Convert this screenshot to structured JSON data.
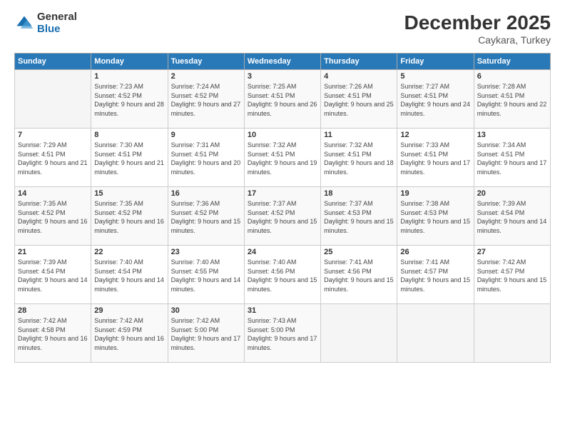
{
  "logo": {
    "general": "General",
    "blue": "Blue"
  },
  "title": "December 2025",
  "location": "Caykara, Turkey",
  "days_header": [
    "Sunday",
    "Monday",
    "Tuesday",
    "Wednesday",
    "Thursday",
    "Friday",
    "Saturday"
  ],
  "weeks": [
    [
      {
        "day": "",
        "sunrise": "",
        "sunset": "",
        "daylight": ""
      },
      {
        "day": "1",
        "sunrise": "Sunrise: 7:23 AM",
        "sunset": "Sunset: 4:52 PM",
        "daylight": "Daylight: 9 hours and 28 minutes."
      },
      {
        "day": "2",
        "sunrise": "Sunrise: 7:24 AM",
        "sunset": "Sunset: 4:52 PM",
        "daylight": "Daylight: 9 hours and 27 minutes."
      },
      {
        "day": "3",
        "sunrise": "Sunrise: 7:25 AM",
        "sunset": "Sunset: 4:51 PM",
        "daylight": "Daylight: 9 hours and 26 minutes."
      },
      {
        "day": "4",
        "sunrise": "Sunrise: 7:26 AM",
        "sunset": "Sunset: 4:51 PM",
        "daylight": "Daylight: 9 hours and 25 minutes."
      },
      {
        "day": "5",
        "sunrise": "Sunrise: 7:27 AM",
        "sunset": "Sunset: 4:51 PM",
        "daylight": "Daylight: 9 hours and 24 minutes."
      },
      {
        "day": "6",
        "sunrise": "Sunrise: 7:28 AM",
        "sunset": "Sunset: 4:51 PM",
        "daylight": "Daylight: 9 hours and 22 minutes."
      }
    ],
    [
      {
        "day": "7",
        "sunrise": "Sunrise: 7:29 AM",
        "sunset": "Sunset: 4:51 PM",
        "daylight": "Daylight: 9 hours and 21 minutes."
      },
      {
        "day": "8",
        "sunrise": "Sunrise: 7:30 AM",
        "sunset": "Sunset: 4:51 PM",
        "daylight": "Daylight: 9 hours and 21 minutes."
      },
      {
        "day": "9",
        "sunrise": "Sunrise: 7:31 AM",
        "sunset": "Sunset: 4:51 PM",
        "daylight": "Daylight: 9 hours and 20 minutes."
      },
      {
        "day": "10",
        "sunrise": "Sunrise: 7:32 AM",
        "sunset": "Sunset: 4:51 PM",
        "daylight": "Daylight: 9 hours and 19 minutes."
      },
      {
        "day": "11",
        "sunrise": "Sunrise: 7:32 AM",
        "sunset": "Sunset: 4:51 PM",
        "daylight": "Daylight: 9 hours and 18 minutes."
      },
      {
        "day": "12",
        "sunrise": "Sunrise: 7:33 AM",
        "sunset": "Sunset: 4:51 PM",
        "daylight": "Daylight: 9 hours and 17 minutes."
      },
      {
        "day": "13",
        "sunrise": "Sunrise: 7:34 AM",
        "sunset": "Sunset: 4:51 PM",
        "daylight": "Daylight: 9 hours and 17 minutes."
      }
    ],
    [
      {
        "day": "14",
        "sunrise": "Sunrise: 7:35 AM",
        "sunset": "Sunset: 4:52 PM",
        "daylight": "Daylight: 9 hours and 16 minutes."
      },
      {
        "day": "15",
        "sunrise": "Sunrise: 7:35 AM",
        "sunset": "Sunset: 4:52 PM",
        "daylight": "Daylight: 9 hours and 16 minutes."
      },
      {
        "day": "16",
        "sunrise": "Sunrise: 7:36 AM",
        "sunset": "Sunset: 4:52 PM",
        "daylight": "Daylight: 9 hours and 15 minutes."
      },
      {
        "day": "17",
        "sunrise": "Sunrise: 7:37 AM",
        "sunset": "Sunset: 4:52 PM",
        "daylight": "Daylight: 9 hours and 15 minutes."
      },
      {
        "day": "18",
        "sunrise": "Sunrise: 7:37 AM",
        "sunset": "Sunset: 4:53 PM",
        "daylight": "Daylight: 9 hours and 15 minutes."
      },
      {
        "day": "19",
        "sunrise": "Sunrise: 7:38 AM",
        "sunset": "Sunset: 4:53 PM",
        "daylight": "Daylight: 9 hours and 15 minutes."
      },
      {
        "day": "20",
        "sunrise": "Sunrise: 7:39 AM",
        "sunset": "Sunset: 4:54 PM",
        "daylight": "Daylight: 9 hours and 14 minutes."
      }
    ],
    [
      {
        "day": "21",
        "sunrise": "Sunrise: 7:39 AM",
        "sunset": "Sunset: 4:54 PM",
        "daylight": "Daylight: 9 hours and 14 minutes."
      },
      {
        "day": "22",
        "sunrise": "Sunrise: 7:40 AM",
        "sunset": "Sunset: 4:54 PM",
        "daylight": "Daylight: 9 hours and 14 minutes."
      },
      {
        "day": "23",
        "sunrise": "Sunrise: 7:40 AM",
        "sunset": "Sunset: 4:55 PM",
        "daylight": "Daylight: 9 hours and 14 minutes."
      },
      {
        "day": "24",
        "sunrise": "Sunrise: 7:40 AM",
        "sunset": "Sunset: 4:56 PM",
        "daylight": "Daylight: 9 hours and 15 minutes."
      },
      {
        "day": "25",
        "sunrise": "Sunrise: 7:41 AM",
        "sunset": "Sunset: 4:56 PM",
        "daylight": "Daylight: 9 hours and 15 minutes."
      },
      {
        "day": "26",
        "sunrise": "Sunrise: 7:41 AM",
        "sunset": "Sunset: 4:57 PM",
        "daylight": "Daylight: 9 hours and 15 minutes."
      },
      {
        "day": "27",
        "sunrise": "Sunrise: 7:42 AM",
        "sunset": "Sunset: 4:57 PM",
        "daylight": "Daylight: 9 hours and 15 minutes."
      }
    ],
    [
      {
        "day": "28",
        "sunrise": "Sunrise: 7:42 AM",
        "sunset": "Sunset: 4:58 PM",
        "daylight": "Daylight: 9 hours and 16 minutes."
      },
      {
        "day": "29",
        "sunrise": "Sunrise: 7:42 AM",
        "sunset": "Sunset: 4:59 PM",
        "daylight": "Daylight: 9 hours and 16 minutes."
      },
      {
        "day": "30",
        "sunrise": "Sunrise: 7:42 AM",
        "sunset": "Sunset: 5:00 PM",
        "daylight": "Daylight: 9 hours and 17 minutes."
      },
      {
        "day": "31",
        "sunrise": "Sunrise: 7:43 AM",
        "sunset": "Sunset: 5:00 PM",
        "daylight": "Daylight: 9 hours and 17 minutes."
      },
      {
        "day": "",
        "sunrise": "",
        "sunset": "",
        "daylight": ""
      },
      {
        "day": "",
        "sunrise": "",
        "sunset": "",
        "daylight": ""
      },
      {
        "day": "",
        "sunrise": "",
        "sunset": "",
        "daylight": ""
      }
    ]
  ]
}
